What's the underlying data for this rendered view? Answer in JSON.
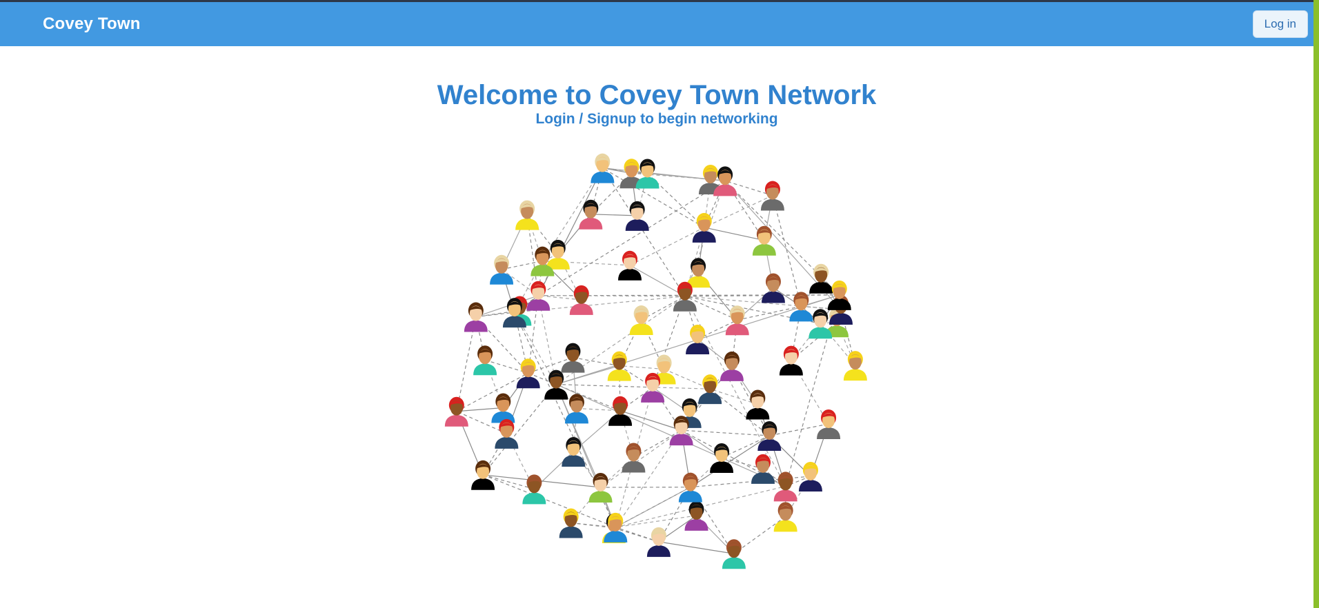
{
  "header": {
    "brand": "Covey Town",
    "login_label": "Log in"
  },
  "hero": {
    "title": "Welcome to Covey Town Network",
    "subtitle": "Login / Signup to begin networking"
  },
  "colors": {
    "navbar": "#4299e1",
    "heading": "#3182ce",
    "button_text": "#2b6cb0",
    "button_bg": "#ebf4fb"
  },
  "illustration": {
    "icon": "people-network-icon"
  }
}
